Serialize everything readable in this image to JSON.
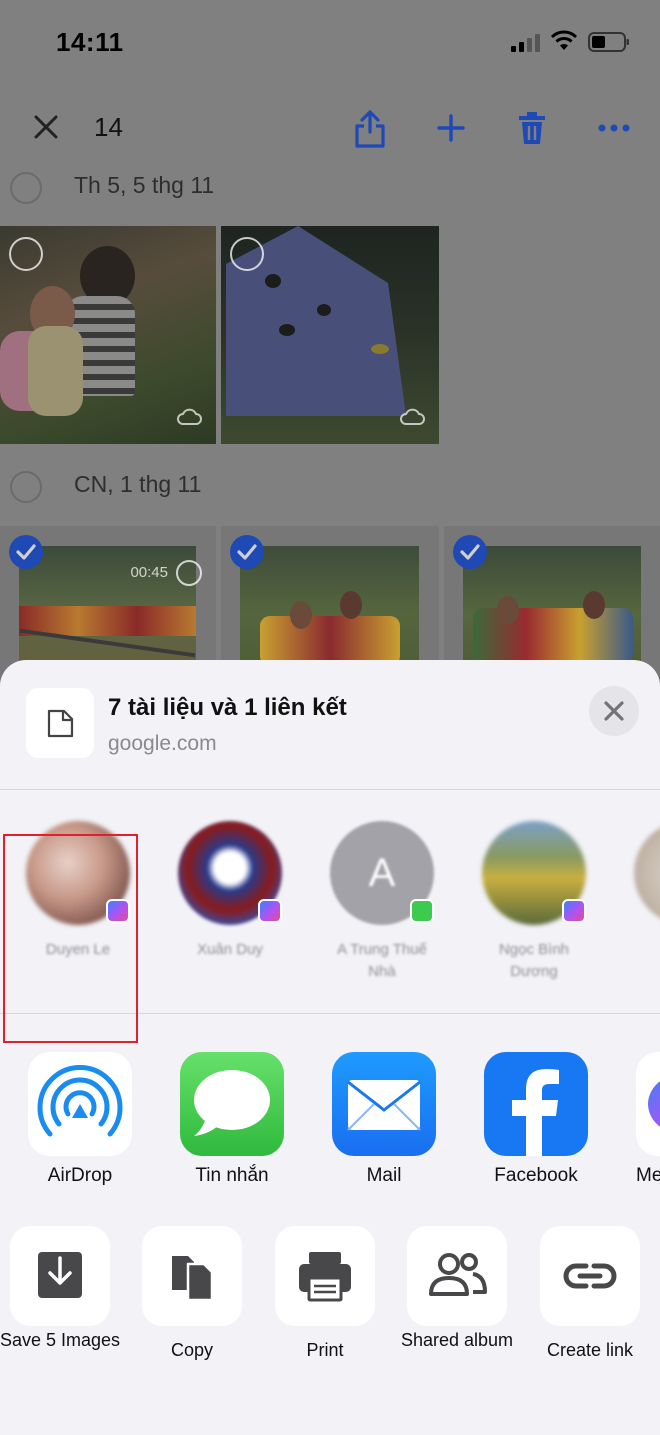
{
  "status_bar": {
    "time": "14:11"
  },
  "toolbar": {
    "selected_count": "14"
  },
  "sections": [
    {
      "date": "Th 5, 5 thg 11"
    },
    {
      "date": "CN, 1 thg 11"
    }
  ],
  "video": {
    "duration": "00:45"
  },
  "share_sheet": {
    "title": "7 tài liệu và 1 liên kết",
    "subtitle": "google.com",
    "people": [
      {
        "name": "Duyen Le"
      },
      {
        "name": "Xuân Duy"
      },
      {
        "name": "A Trung Thuế Nhà",
        "initial": "A"
      },
      {
        "name": "Ngọc Bình Dương"
      }
    ],
    "apps": [
      {
        "label": "AirDrop"
      },
      {
        "label": "Tin nhắn"
      },
      {
        "label": "Mail"
      },
      {
        "label": "Facebook"
      },
      {
        "label": "Me"
      }
    ],
    "actions": [
      {
        "label": "Save 5 Images"
      },
      {
        "label": "Copy"
      },
      {
        "label": "Print"
      },
      {
        "label": "Shared album"
      },
      {
        "label": "Create link"
      }
    ]
  },
  "colors": {
    "accent_blue": "#1f49b4",
    "highlight_red": "#e0202a",
    "messages_green": "#3ec94f",
    "facebook_blue": "#1877f2"
  }
}
